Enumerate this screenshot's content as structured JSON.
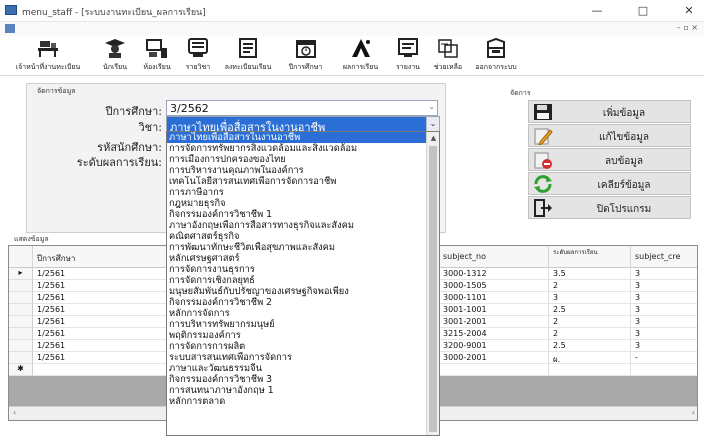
{
  "window": {
    "title": "menu_staff - [ระบบงานทะเบียน_ผลการเรียน]",
    "minimize": "—",
    "maximize": "□",
    "close": "✕",
    "mdi_controls": "– ▫ ×"
  },
  "toolbar": {
    "items": [
      {
        "label": "เจ้าหน้าที่งานทะเบียน",
        "icon": "office-desk-icon"
      },
      {
        "label": "นักเรียน",
        "icon": "student-icon"
      },
      {
        "label": "ห้องเรียน",
        "icon": "classroom-icon"
      },
      {
        "label": "รายวิชา",
        "icon": "subject-icon"
      },
      {
        "label": "ลงทะเบียนเรียน",
        "icon": "register-icon"
      },
      {
        "label": "ปีการศึกษา",
        "icon": "calendar-icon"
      },
      {
        "label": "ผลการเรียน",
        "icon": "grade-icon"
      },
      {
        "label": "รายงาน",
        "icon": "report-icon"
      },
      {
        "label": "ช่วยเหลือ",
        "icon": "help-icon"
      },
      {
        "label": "ออกจากระบบ",
        "icon": "exit-icon"
      }
    ]
  },
  "form": {
    "caption": "จัดการข้อมูล",
    "year_label": "ปีการศึกษา:",
    "year_value": "3/2562",
    "subject_label": "วิชา:",
    "subject_value": "ภาษาไทยเพื่อสื่อสารในงานอาชีพ",
    "code_label": "รหัสนักศึกษา:",
    "level_label": "ระดับผลการเรียน:"
  },
  "manage": {
    "caption": "จัดการ",
    "buttons": [
      {
        "label": "เพิ่มข้อมูล",
        "icon": "save-icon"
      },
      {
        "label": "แก้ไขข้อมูล",
        "icon": "edit-icon"
      },
      {
        "label": "ลบข้อมูล",
        "icon": "delete-icon"
      },
      {
        "label": "เคลียร์ข้อมูล",
        "icon": "refresh-icon"
      },
      {
        "label": "ปิดโปรแกรม",
        "icon": "exit-door-icon"
      }
    ]
  },
  "grid": {
    "caption": "แสดงข้อมูล",
    "columns": [
      "ปีการศึกษา",
      "",
      "subject_no",
      "ระดับผลการเรียน",
      "subject_cre"
    ],
    "rows": [
      {
        "year": "1/2561",
        "subject_no": "3000-1312",
        "grade": "3.5",
        "credit": "3",
        "current": true
      },
      {
        "year": "1/2561",
        "subject_no": "3000-1505",
        "grade": "2",
        "credit": "3"
      },
      {
        "year": "1/2561",
        "subject_no": "3000-1101",
        "grade": "3",
        "credit": "3"
      },
      {
        "year": "1/2561",
        "subject_no": "3001-1001",
        "grade": "2.5",
        "credit": "3"
      },
      {
        "year": "1/2561",
        "subject_no": "3001-2001",
        "grade": "2",
        "credit": "3"
      },
      {
        "year": "1/2561",
        "subject_no": "3215-2004",
        "grade": "2",
        "credit": "3"
      },
      {
        "year": "1/2561",
        "subject_no": "3200-9001",
        "grade": "2.5",
        "credit": "3"
      },
      {
        "year": "1/2561",
        "subject_no": "3000-2001",
        "grade": "ผ.",
        "credit": "-"
      }
    ],
    "current_row_marker": "▸",
    "new_row_marker": "✱"
  },
  "dropdown": {
    "items": [
      "ภาษาไทยเพื่อสื่อสารในงานอาชีพ",
      "การจัดการทรัพยากรสิ่งแวดล้อมและสิ่งแวดล้อม",
      "การเมืองการปกครองของไทย",
      "การบริหารงานคุณภาพในองค์การ",
      "เทคโนโลยีสารสนเทศเพื่อการจัดการอาชีพ",
      "การภาษีอากร",
      "กฎหมายธุรกิจ",
      "กิจกรรมองค์การวิชาชีพ 1",
      "ภาษาอังกฤษเพื่อการสื่อสารทางธุรกิจและสังคม",
      "คณิตศาสตร์ธุรกิจ",
      "การพัฒนาทักษะชีวิตเพื่อสุขภาพและสังคม",
      "หลักเศรษฐศาสตร์",
      "การจัดการงานธุรการ",
      "การจัดการเชิงกลยุทธ์",
      "มนุษยสัมพันธ์กับปรัชญาของเศรษฐกิจพอเพียง",
      "กิจกรรมองค์การวิชาชีพ 2",
      "หลักการจัดการ",
      "การบริหารทรัพยากรมนุษย์",
      "พฤติกรรมองค์การ",
      "การจัดการการผลิต",
      "ระบบสารสนเทศเพื่อการจัดการ",
      "ภาษาและวัฒนธรรมจีน",
      "กิจกรรมองค์การวิชาชีพ 3",
      "การสนทนาภาษาอังกฤษ 1",
      "หลักการตลาด"
    ],
    "selected_index": 0,
    "scroll_up": "▲"
  },
  "colors": {
    "selection": "#2b6fd6",
    "grid_background": "#a9a9a9",
    "panel": "#f3f3f3"
  }
}
